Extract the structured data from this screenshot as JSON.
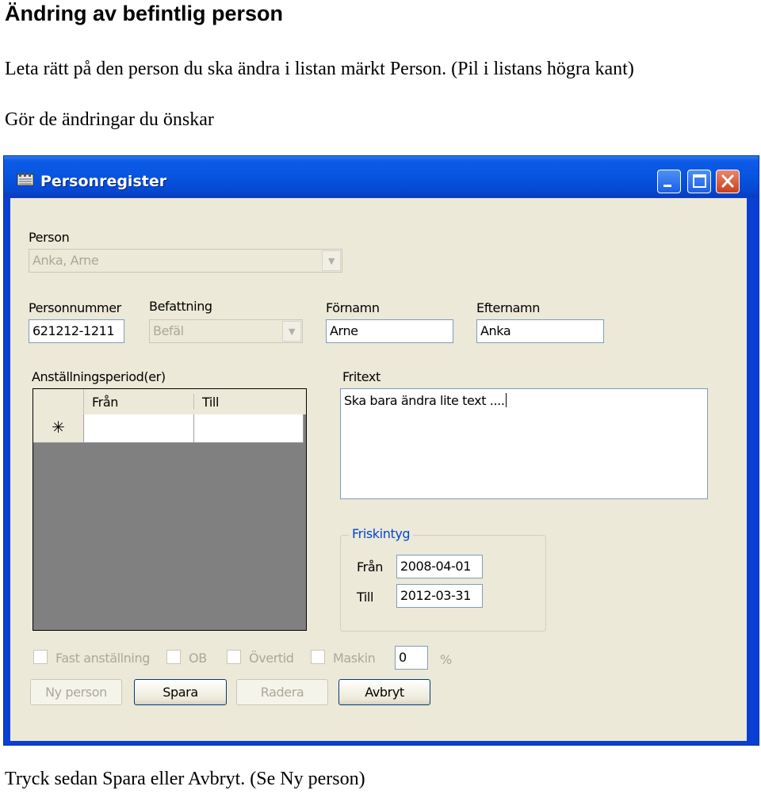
{
  "document": {
    "heading": "Ändring av befintlig person",
    "instruction_1": "Leta rätt på den person du ska ändra i listan märkt Person. (Pil i listans högra kant)",
    "instruction_2": "Gör de ändringar du önskar",
    "footer": "Tryck sedan Spara eller Avbryt. (Se Ny person)"
  },
  "window": {
    "title": "Personregister",
    "title_icon": "app-register-icon",
    "controls": [
      "minimize-icon",
      "maximize-icon",
      "close-icon"
    ]
  },
  "form": {
    "person_label": "Person",
    "person_value": "Anka, Arne",
    "personnummer_label": "Personnummer",
    "personnummer_value": "621212-1211",
    "befattning_label": "Befattning",
    "befattning_value": "Befäl",
    "fornamn_label": "Förnamn",
    "fornamn_value": "Arne",
    "efternamn_label": "Efternamn",
    "efternamn_value": "Anka",
    "period_label": "Anställningsperiod(er)",
    "grid_columns": [
      "Från",
      "Till"
    ],
    "grid_new_row_marker": "✳",
    "fritext_label": "Fritext",
    "fritext_value": "Ska bara ändra lite text ....",
    "friskintyg": {
      "title": "Friskintyg",
      "fran_label": "Från",
      "fran_value": "2008-04-01",
      "till_label": "Till",
      "till_value": "2012-03-31"
    },
    "checkboxes": [
      "Fast anställning",
      "OB",
      "Övertid",
      "Maskin"
    ],
    "percent_value": "0",
    "percent_unit": "%"
  },
  "buttons": {
    "new_person": "Ny person",
    "save": "Spara",
    "delete": "Radera",
    "cancel": "Avbryt"
  },
  "colors": {
    "titlebar": "#0654e0",
    "window_face": "#ece9d8",
    "group_title": "#0046d5",
    "disabled_text": "#aca899"
  }
}
